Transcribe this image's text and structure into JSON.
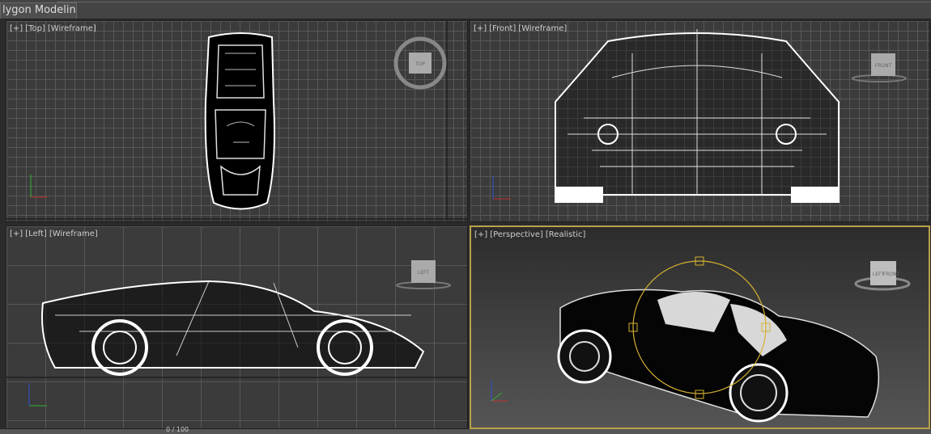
{
  "ribbon": {
    "active_tab": "Polygon Modeling",
    "visible_tab_text": "lygon Modeling"
  },
  "viewports": [
    {
      "id": "top",
      "plus": "[+]",
      "view": "[Top]",
      "shading": "[Wireframe]",
      "viewcube": "TOP"
    },
    {
      "id": "front",
      "plus": "[+]",
      "view": "[Front]",
      "shading": "[Wireframe]",
      "viewcube": "FRONT"
    },
    {
      "id": "left",
      "plus": "[+]",
      "view": "[Left]",
      "shading": "[Wireframe]",
      "viewcube": "LEFT"
    },
    {
      "id": "perspective",
      "plus": "[+]",
      "view": "[Perspective]",
      "shading": "[Realistic]",
      "viewcube": "LEFT",
      "viewcube2": "FRONT",
      "active": true
    }
  ],
  "timeline": {
    "frame": "0 / 100"
  },
  "colors": {
    "active_border": "#b9a24b",
    "gizmo": "#d4b030",
    "axis_x": "#c03030",
    "axis_y": "#30b030",
    "axis_z": "#3050d0"
  }
}
